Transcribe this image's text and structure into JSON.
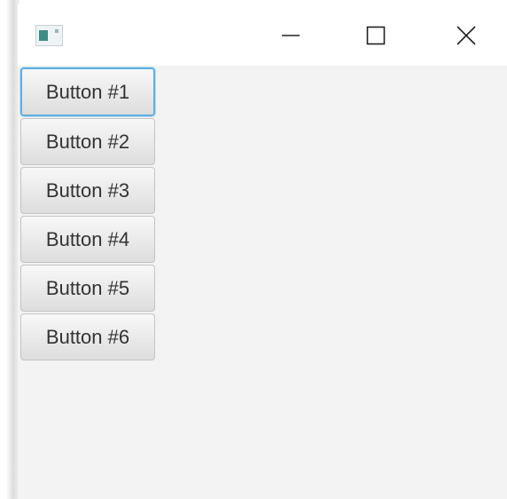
{
  "window": {
    "title": "",
    "controls": {
      "minimize_icon": "minimize-icon",
      "maximize_icon": "maximize-icon",
      "close_icon": "close-icon"
    },
    "app_icon": "app-window-icon"
  },
  "buttons": [
    {
      "label": "Button #1",
      "focused": true
    },
    {
      "label": "Button #2",
      "focused": false
    },
    {
      "label": "Button #3",
      "focused": false
    },
    {
      "label": "Button #4",
      "focused": false
    },
    {
      "label": "Button #5",
      "focused": false
    },
    {
      "label": "Button #6",
      "focused": false
    }
  ],
  "colors": {
    "focus_ring": "#5fb0de",
    "window_background": "#f3f3f3",
    "titlebar_background": "#ffffff",
    "button_text": "#333333"
  }
}
